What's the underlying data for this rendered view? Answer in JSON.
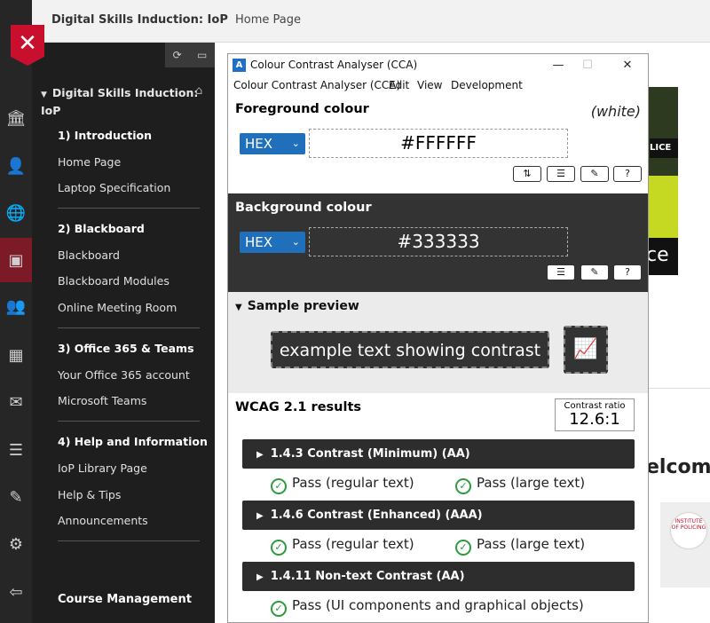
{
  "bb": {
    "course_title": "Digital Skills Induction: IoP",
    "crumb": "Home Page",
    "sidebar": {
      "heading": "Digital Skills Induction: IoP",
      "sections": [
        {
          "title": "1) Introduction",
          "items": [
            "Home Page",
            "Laptop Specification"
          ]
        },
        {
          "title": "2) Blackboard",
          "items": [
            "Blackboard",
            "Blackboard Modules",
            "Online Meeting Room"
          ]
        },
        {
          "title": "3) Office 365 & Teams",
          "items": [
            "Your Office 365 account",
            "Microsoft Teams"
          ]
        },
        {
          "title": "4) Help and Information",
          "items": [
            "IoP Library Page",
            "Help & Tips",
            "Announcements"
          ]
        }
      ],
      "footer": "Course Management"
    },
    "bg_hero_text": "LICE",
    "bg_hero_tail": "ce",
    "bg_welcome": "elcome"
  },
  "cca": {
    "window_title": "Colour Contrast Analyser (CCA)",
    "menu": [
      "Colour Contrast Analyser (CCA)",
      "Edit",
      "View",
      "Development"
    ],
    "foreground": {
      "title": "Foreground colour",
      "name": "(white)",
      "format": "HEX",
      "value": "#FFFFFF",
      "color": "#FFFFFF"
    },
    "background": {
      "title": "Background colour",
      "format": "HEX",
      "value": "#333333",
      "color": "#333333"
    },
    "sample": {
      "title": "Sample preview",
      "text": "example text showing contrast"
    },
    "wcag": {
      "title": "WCAG 2.1 results",
      "ratio_label": "Contrast ratio",
      "ratio_value": "12.6:1",
      "criteria": [
        {
          "label": "1.4.3 Contrast (Minimum) (AA)",
          "results": [
            "Pass (regular text)",
            "Pass (large text)"
          ]
        },
        {
          "label": "1.4.6 Contrast (Enhanced) (AAA)",
          "results": [
            "Pass (regular text)",
            "Pass (large text)"
          ]
        },
        {
          "label": "1.4.11 Non-text Contrast (AA)",
          "results": [
            "Pass (UI components and graphical objects)"
          ]
        }
      ],
      "pass_color": "#2e9a3e"
    }
  },
  "colors": {
    "accent_red": "#c8102e",
    "sidebar_bg": "#1e1e1e",
    "hex_select": "#1f6fba"
  },
  "icons": [
    "close-icon",
    "institution-icon",
    "user-icon",
    "globe-icon",
    "courses-icon",
    "groups-icon",
    "calendar-icon",
    "mail-icon",
    "grades-icon",
    "edit-icon",
    "tools-icon",
    "signout-icon",
    "refresh-icon",
    "folder-icon",
    "home-icon",
    "swap-icon",
    "sliders-icon",
    "eyedropper-icon",
    "help-icon",
    "graph-icon",
    "check-icon"
  ]
}
